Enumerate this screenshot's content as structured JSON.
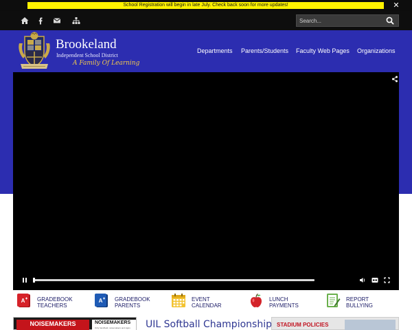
{
  "alert": {
    "message": "School Registration will begin in late July. Check back soon for more updates!",
    "close_icon": "close-icon"
  },
  "topbar": {
    "icons": [
      "home-icon",
      "facebook-icon",
      "email-icon",
      "sitemap-icon"
    ],
    "search": {
      "placeholder": "Search...",
      "button_icon": "search-icon"
    }
  },
  "logo": {
    "name": "Brookeland",
    "subtitle": "Independent School District",
    "tagline": "A Family Of Learning"
  },
  "nav": {
    "items": [
      "Departments",
      "Parents/Students",
      "Faculty Web Pages",
      "Organizations"
    ]
  },
  "video": {
    "controls": [
      "pause-icon",
      "volume-icon",
      "captions-icon",
      "fullscreen-icon"
    ],
    "progress": 0.0
  },
  "quick_links": [
    {
      "line1": "GRADEBOOK",
      "line2": "TEACHERS",
      "icon": "gradebook-red-icon"
    },
    {
      "line1": "GRADEBOOK",
      "line2": "PARENTS",
      "icon": "gradebook-blue-icon"
    },
    {
      "line1": "EVENT",
      "line2": "CALENDAR",
      "icon": "calendar-icon"
    },
    {
      "line1": "LUNCH",
      "line2": "PAYMENTS",
      "icon": "apple-icon"
    },
    {
      "line1": "REPORT",
      "line2": "BULLYING",
      "icon": "report-icon"
    }
  ],
  "news": {
    "card1_title": "NOISEMAKERS",
    "card1_side_title": "NOISEMAKERS",
    "card1_side_small": "Only handheld, noisemakers and signs",
    "headline": "UIL Softball Championship",
    "card3_title": "STADIUM POLICIES"
  },
  "colors": {
    "header_blue": "#2c2db0",
    "alert_yellow": "#fff200",
    "gold": "#f2c94c",
    "link_navy": "#1a1a66"
  }
}
